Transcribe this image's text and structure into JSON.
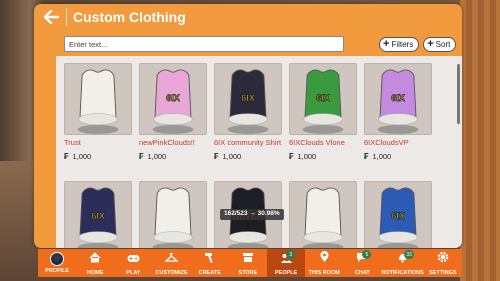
{
  "header": {
    "title": "Custom Clothing"
  },
  "search": {
    "placeholder": "Enter text...",
    "value": ""
  },
  "buttons": {
    "filters": "Filters",
    "sort": "Sort"
  },
  "currency_symbol": "₣",
  "items": [
    {
      "name": "Trust",
      "price": "1,000",
      "color": "#f1efe8",
      "logo": ""
    },
    {
      "name": "newPinkClouds!!",
      "price": "1,000",
      "color": "#e9a7d8",
      "logo": "6IX"
    },
    {
      "name": "6IX community Shirt",
      "price": "1,000",
      "color": "#2a2a3a",
      "logo": "6IX"
    },
    {
      "name": "6IXClouds Vlone",
      "price": "1,000",
      "color": "#3a9a3e",
      "logo": "6IX"
    },
    {
      "name": "6IXCloudsVP",
      "price": "1,000",
      "color": "#c38ae0",
      "logo": "6IX"
    },
    {
      "name": "",
      "price": "",
      "color": "#2b2d5a",
      "logo": "6IX"
    },
    {
      "name": "",
      "price": "",
      "color": "#f1efe8",
      "logo": ""
    },
    {
      "name": "",
      "price": "",
      "color": "#1d1d24",
      "logo": "NEVER"
    },
    {
      "name": "",
      "price": "",
      "color": "#f1efe8",
      "logo": ""
    },
    {
      "name": "",
      "price": "",
      "color": "#2c5bb5",
      "logo": "6IX"
    }
  ],
  "tooltip": "162/523 → 30.98%",
  "nav": [
    {
      "label": "PROFILE",
      "icon": "avatar-icon",
      "badge": ""
    },
    {
      "label": "HOME",
      "icon": "home-icon",
      "badge": ""
    },
    {
      "label": "PLAY",
      "icon": "gamepad-icon",
      "badge": ""
    },
    {
      "label": "CUSTOMIZE",
      "icon": "hanger-icon",
      "badge": ""
    },
    {
      "label": "CREATE",
      "icon": "hammer-icon",
      "badge": ""
    },
    {
      "label": "STORE",
      "icon": "store-icon",
      "badge": ""
    },
    {
      "label": "PEOPLE",
      "icon": "people-icon",
      "badge": "3"
    },
    {
      "label": "THIS ROOM",
      "icon": "location-pin-icon",
      "badge": ""
    },
    {
      "label": "CHAT",
      "icon": "chat-icon",
      "badge": "5"
    },
    {
      "label": "NOTIFICATIONS",
      "icon": "bell-icon",
      "badge": "33"
    },
    {
      "label": "SETTINGS",
      "icon": "gear-icon",
      "badge": ""
    }
  ],
  "nav_active": "PEOPLE"
}
